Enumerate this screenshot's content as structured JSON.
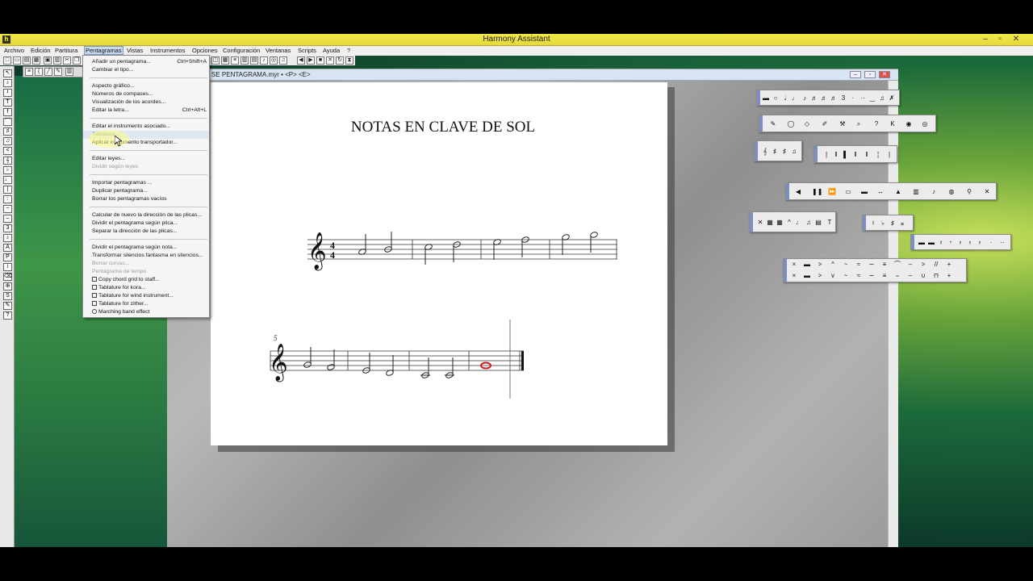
{
  "app": {
    "title": "Harmony Assistant",
    "icon_letter": "h"
  },
  "window_controls": {
    "minimize": "–",
    "maximize": "▫",
    "close": "✕"
  },
  "menubar": {
    "items": [
      "Archivo",
      "Edición",
      "Partitura",
      "Pentagramas",
      "Vistas",
      "Instrumentos",
      "Opciones",
      "Configuración",
      "Ventanas",
      "Scripts",
      "Ayuda",
      "?"
    ],
    "active": "Pentagramas"
  },
  "document": {
    "title": "SE PENTAGRAMA.myr • <P> <E>",
    "score_title": "NOTAS EN CLAVE DE SOL",
    "measure_number": "5",
    "time_signature_top": "4",
    "time_signature_bottom": "4"
  },
  "pentagramas_menu": {
    "items": [
      {
        "label": "Añadir un pentagrama...",
        "shortcut": "Ctrl+Shift+A",
        "disabled": false
      },
      {
        "label": "Cambiar el tipo...",
        "shortcut": "",
        "disabled": false
      },
      {
        "sep": true
      },
      {
        "label": "Aspecto gráfico...",
        "shortcut": "",
        "disabled": false
      },
      {
        "label": "Números de compases...",
        "shortcut": "",
        "disabled": false
      },
      {
        "label": "Visualización de los acordes...",
        "shortcut": "",
        "disabled": false
      },
      {
        "label": "Editar la letra...",
        "shortcut": "Ctrl+Alt+L",
        "disabled": false
      },
      {
        "sep": true
      },
      {
        "label": "Editar el instrumento asociado...",
        "shortcut": "",
        "disabled": false
      },
      {
        "label": "Tablatura...",
        "shortcut": "",
        "disabled": true,
        "highlight": true
      },
      {
        "label": "Aplicar instrumento transportador...",
        "shortcut": "",
        "disabled": false
      },
      {
        "sep": true
      },
      {
        "label": "Editar leyes...",
        "shortcut": "",
        "disabled": false
      },
      {
        "label": "Dividir según leyes",
        "shortcut": "",
        "disabled": true
      },
      {
        "sep": true
      },
      {
        "label": "Importar pentagramas ...",
        "shortcut": "",
        "disabled": false
      },
      {
        "label": "Duplicar pentagrama...",
        "shortcut": "",
        "disabled": false
      },
      {
        "label": "Borrar los pentagramas vacíos",
        "shortcut": "",
        "disabled": false
      },
      {
        "sep": true
      },
      {
        "label": "Calcular de nuevo la dirección de las plicas...",
        "shortcut": "",
        "disabled": false
      },
      {
        "label": "Dividir el pentagrama según plica...",
        "shortcut": "",
        "disabled": false
      },
      {
        "label": "Separar la dirección de las plicas...",
        "shortcut": "",
        "disabled": false
      },
      {
        "sep": true
      },
      {
        "label": "Dividir el pentagrama según nota...",
        "shortcut": "",
        "disabled": false
      },
      {
        "label": "Transformar silencios fantasma en silencios...",
        "shortcut": "",
        "disabled": false
      },
      {
        "label": "Borrar curvas...",
        "shortcut": "",
        "disabled": true
      },
      {
        "label": "Pentagrama de tempo",
        "shortcut": "",
        "disabled": true
      },
      {
        "label": "Copy chord grid to staff...",
        "shortcut": "",
        "disabled": false,
        "icon": "checkbox"
      },
      {
        "label": "Tablature for kora...",
        "shortcut": "",
        "disabled": false,
        "icon": "checkbox"
      },
      {
        "label": "Tablature for wind instrument...",
        "shortcut": "",
        "disabled": false,
        "icon": "checkbox"
      },
      {
        "label": "Tablature for zither...",
        "shortcut": "",
        "disabled": false,
        "icon": "checkbox"
      },
      {
        "label": "Marching band effect",
        "shortcut": "",
        "disabled": false,
        "icon": "circle"
      }
    ]
  },
  "colors": {
    "titlebar": "#e8dc40",
    "menu_highlight": "#dfe7f3",
    "highlight_note": "#d4181c",
    "palette_grip": "#7a8fc0"
  }
}
